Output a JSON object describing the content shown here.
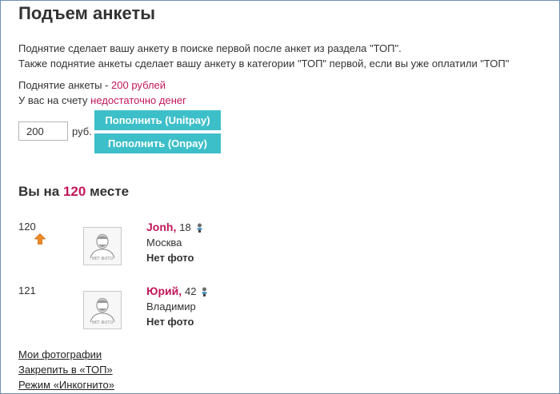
{
  "page": {
    "title": "Подъем анкеты",
    "description_line1": "Поднятие сделает вашу анкету в поиске первой после анкет из раздела \"ТОП\".",
    "description_line2": "Также поднятие анкеты сделает вашу анкету в категории \"ТОП\" первой, если вы уже оплатили \"ТОП\""
  },
  "pricing": {
    "label": "Поднятие анкеты - ",
    "price": "200 рублей",
    "balance_label": "У вас на счету ",
    "balance_status": "недостаточно денег"
  },
  "topup": {
    "amount_value": "200",
    "currency_label": "руб.",
    "unitpay_label": "Пополнить (Unitpay)",
    "onpay_label": "Пополнить (Onpay)"
  },
  "rank": {
    "prefix": "Вы на ",
    "position": "120",
    "suffix": " месте"
  },
  "entries": [
    {
      "rank": "120",
      "name": "Jonh,",
      "age": "18",
      "city": "Москва",
      "photo_status": "Нет фото",
      "photo_caption": "НЕТ ФОТО",
      "has_up_arrow": true
    },
    {
      "rank": "121",
      "name": "Юрий,",
      "age": "42",
      "city": "Владимир",
      "photo_status": "Нет фото",
      "photo_caption": "НЕТ ФОТО",
      "has_up_arrow": false
    }
  ],
  "links": {
    "my_photos": "Мои фотографии",
    "pin_top": "Закрепить в «ТОП»",
    "incognito": "Режим «Инкогнито»"
  },
  "icons": {
    "up_arrow": "arrow-up-icon",
    "gender": "male-icon",
    "avatar_placeholder": "no-photo-avatar-icon"
  },
  "colors": {
    "accent": "#c2185b",
    "button": "#3dbfc9",
    "arrow": "#f08a24",
    "frame_border": "#6f8fb8"
  }
}
